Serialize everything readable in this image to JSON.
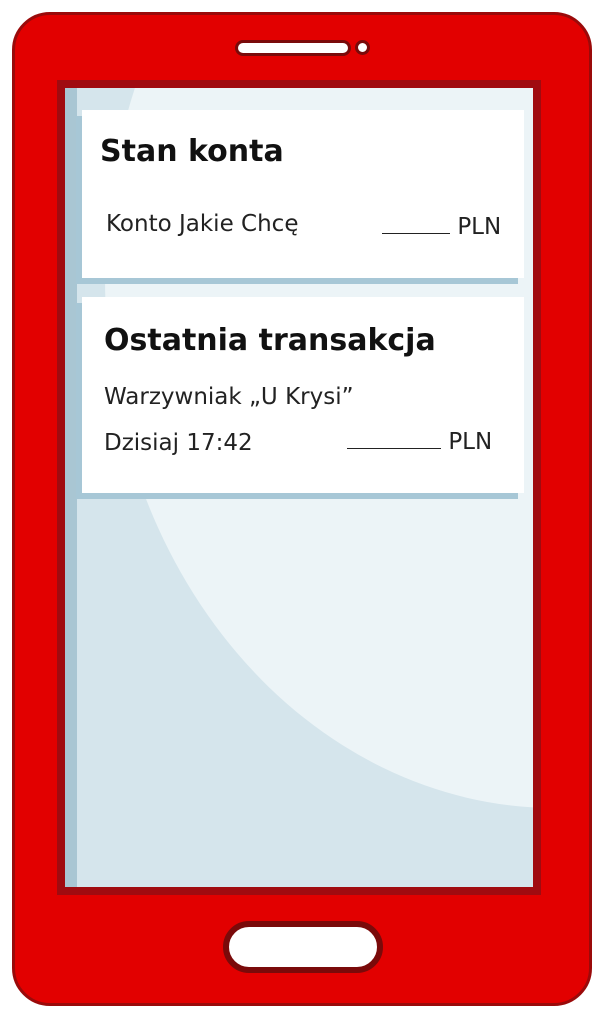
{
  "balance_card": {
    "title": "Stan konta",
    "account_name": "Konto Jakie Chcę",
    "currency": "PLN"
  },
  "last_transaction_card": {
    "title": "Ostatnia transakcja",
    "merchant": "Warzywniak „U Krysi”",
    "datetime": "Dzisiaj 17:42",
    "currency": "PLN"
  },
  "colors": {
    "phone_body": "#e20000",
    "phone_outline": "#9a0a0a",
    "screen_bg": "#d5e5ec",
    "card_shadow": "#a7c7d6"
  }
}
